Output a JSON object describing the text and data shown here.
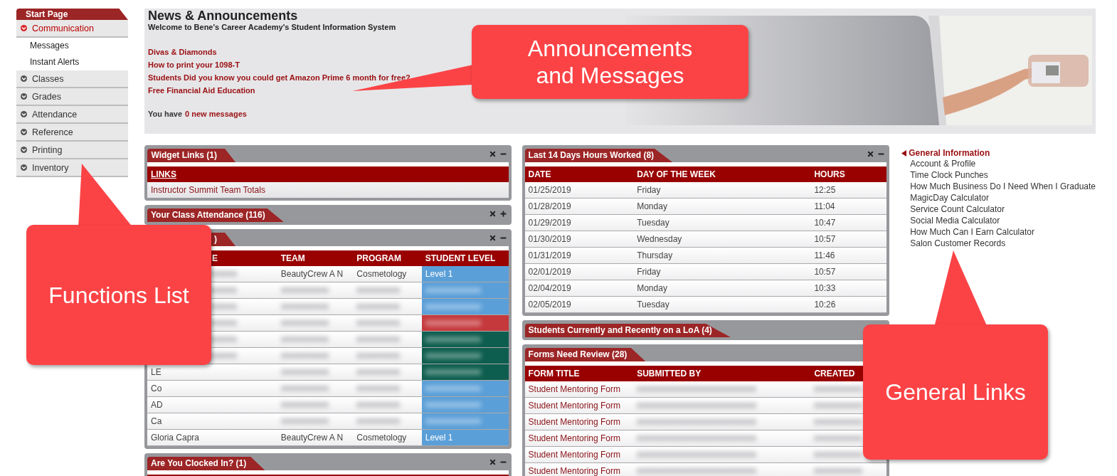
{
  "sidebar": {
    "header": "Start Page",
    "items": [
      {
        "label": "Communication",
        "expanded": true,
        "children": [
          {
            "label": "Messages"
          },
          {
            "label": "Instant Alerts"
          }
        ]
      },
      {
        "label": "Classes",
        "expanded": false
      },
      {
        "label": "Grades",
        "expanded": false
      },
      {
        "label": "Attendance",
        "expanded": false
      },
      {
        "label": "Reference",
        "expanded": false
      },
      {
        "label": "Printing",
        "expanded": false
      },
      {
        "label": "Inventory",
        "expanded": false
      }
    ]
  },
  "news": {
    "title": "News & Announcements",
    "welcome": "Welcome to Bene's Career Academy's Student Information System",
    "links": [
      "Divas & Diamonds",
      "How to print your 1098-T",
      "Students Did you know you could get Amazon Prime 6 month for free?",
      "Free Financial Aid Education"
    ],
    "messages_prefix": "You have",
    "messages_link": "0 new messages"
  },
  "left_widgets": [
    {
      "title": "Widget Links (1)",
      "expanded": true,
      "controls": true,
      "kind": "links",
      "heading": "LINKS",
      "links": [
        "Instructor Summit Team Totals"
      ]
    },
    {
      "title": "Your Class Attendance (116)",
      "expanded": false,
      "controls": true
    },
    {
      "title": ")",
      "expanded": true,
      "controls": true,
      "kind": "table",
      "columns": [
        "E",
        "TEAM",
        "PROGRAM",
        "STUDENT LEVEL"
      ],
      "rows": [
        {
          "color": "#5b9fd8",
          "cells": [
            {
              "blurred": true
            },
            "BeautyCrew A N",
            "Cosmetology",
            "Level 1"
          ]
        },
        {
          "color": "#5b9fd8",
          "cells": [
            {
              "blurred": true
            },
            {
              "blurred": true
            },
            {
              "blurred": true
            },
            {
              "blurred": true
            }
          ]
        },
        {
          "color": "#5b9fd8",
          "cells": [
            {
              "blurred": true
            },
            {
              "blurred": true
            },
            {
              "blurred": true
            },
            {
              "blurred": true
            }
          ]
        },
        {
          "color": "#c5383b",
          "cells": [
            {
              "blurred": true
            },
            {
              "blurred": true
            },
            {
              "blurred": true
            },
            {
              "blurred": true
            }
          ]
        },
        {
          "color": "#0e5e4f",
          "cells": [
            {
              "blurred": true
            },
            {
              "blurred": true
            },
            {
              "blurred": true
            },
            {
              "blurred": true
            }
          ]
        },
        {
          "color": "#0e5e4f",
          "cells": [
            {
              "blurred": true
            },
            {
              "blurred": true
            },
            {
              "blurred": true
            },
            {
              "blurred": true
            }
          ]
        },
        {
          "color": "#0e5e4f",
          "cells": [
            "LE",
            {
              "blurred": true
            },
            {
              "blurred": true
            },
            {
              "blurred": true
            }
          ]
        },
        {
          "color": "#5b9fd8",
          "cells": [
            "Co",
            {
              "blurred": true
            },
            {
              "blurred": true
            },
            {
              "blurred": true
            }
          ]
        },
        {
          "color": "#5b9fd8",
          "cells": [
            "AD",
            {
              "blurred": true
            },
            {
              "blurred": true
            },
            {
              "blurred": true
            }
          ]
        },
        {
          "color": "#5b9fd8",
          "cells": [
            "Ca",
            {
              "blurred": true
            },
            {
              "blurred": true
            },
            {
              "blurred": true
            }
          ]
        },
        {
          "color": "#5b9fd8",
          "cells": [
            "Gloria Capra",
            "BeautyCrew A N",
            "Cosmetology",
            "Level 1"
          ]
        }
      ]
    },
    {
      "title": "Are You Clocked In? (1)",
      "expanded": true,
      "controls": true,
      "kind": "stub"
    }
  ],
  "middle_widgets": [
    {
      "title": "Last 14 Days Hours Worked (8)",
      "expanded": true,
      "controls": true,
      "kind": "table",
      "columns": [
        "DATE",
        "DAY OF THE WEEK",
        "HOURS"
      ],
      "rows": [
        {
          "cells": [
            "01/25/2019",
            "Friday",
            "12:25"
          ]
        },
        {
          "cells": [
            "01/28/2019",
            "Monday",
            "11:04"
          ]
        },
        {
          "cells": [
            "01/29/2019",
            "Tuesday",
            "10:47"
          ]
        },
        {
          "cells": [
            "01/30/2019",
            "Wednesday",
            "10:57"
          ]
        },
        {
          "cells": [
            "01/31/2019",
            "Thursday",
            "11:46"
          ]
        },
        {
          "cells": [
            "02/01/2019",
            "Friday",
            "10:57"
          ]
        },
        {
          "cells": [
            "02/04/2019",
            "Monday",
            "10:33"
          ]
        },
        {
          "cells": [
            "02/05/2019",
            "Tuesday",
            "10:26"
          ]
        }
      ]
    },
    {
      "title": "Students Currently and Recently on a LoA (4)",
      "expanded": false,
      "controls": false
    },
    {
      "title": "Forms Need Review (28)",
      "expanded": true,
      "controls": false,
      "kind": "table",
      "link_column": true,
      "columns": [
        "FORM TITLE",
        "SUBMITTED BY",
        "CREATED"
      ],
      "rows": [
        {
          "cells": [
            "Student Mentoring Form",
            {
              "blurred": true
            },
            {
              "blurred": true
            }
          ]
        },
        {
          "cells": [
            "Student Mentoring Form",
            {
              "blurred": true
            },
            {
              "blurred": true
            }
          ]
        },
        {
          "cells": [
            "Student Mentoring Form",
            {
              "blurred": true
            },
            {
              "blurred": true
            }
          ]
        },
        {
          "cells": [
            "Student Mentoring Form",
            {
              "blurred": true
            },
            {
              "blurred": true
            }
          ]
        },
        {
          "cells": [
            "Student Mentoring Form",
            {
              "blurred": true
            },
            {
              "blurred": true
            }
          ]
        },
        {
          "cells": [
            "Student Mentoring Form",
            {
              "blurred": true
            },
            {
              "blurred": true
            }
          ]
        }
      ]
    }
  ],
  "general_links": {
    "title": "General Information",
    "expanded": true,
    "items": [
      "Account & Profile",
      "Time Clock Punches",
      "How Much Business Do I Need When I Graduate",
      "MagicDay Calculator",
      "Service Count Calculator",
      "Social Media Calculator",
      "How Much Can I Earn Calculator",
      "Salon Customer Records"
    ]
  },
  "callouts": [
    {
      "text": "Announcements and Messages"
    },
    {
      "text": "Functions List"
    },
    {
      "text": "General Links"
    }
  ]
}
